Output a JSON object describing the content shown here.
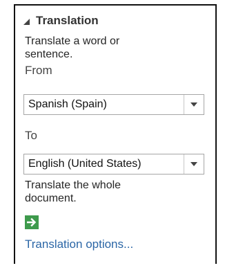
{
  "section": {
    "title": "Translation"
  },
  "translate_word": {
    "description": "Translate a word or sentence.",
    "from_label": "From",
    "from_value": "Spanish (Spain)",
    "to_label": "To",
    "to_value": "English (United States)"
  },
  "translate_document": {
    "description": "Translate the whole document."
  },
  "options_link": "Translation options...",
  "colors": {
    "go_button": "#3e9a4c",
    "link": "#2b66a6"
  },
  "icons": {
    "collapse": "collapse-triangle-icon",
    "dropdown": "chevron-down-icon",
    "go": "arrow-right-icon"
  }
}
